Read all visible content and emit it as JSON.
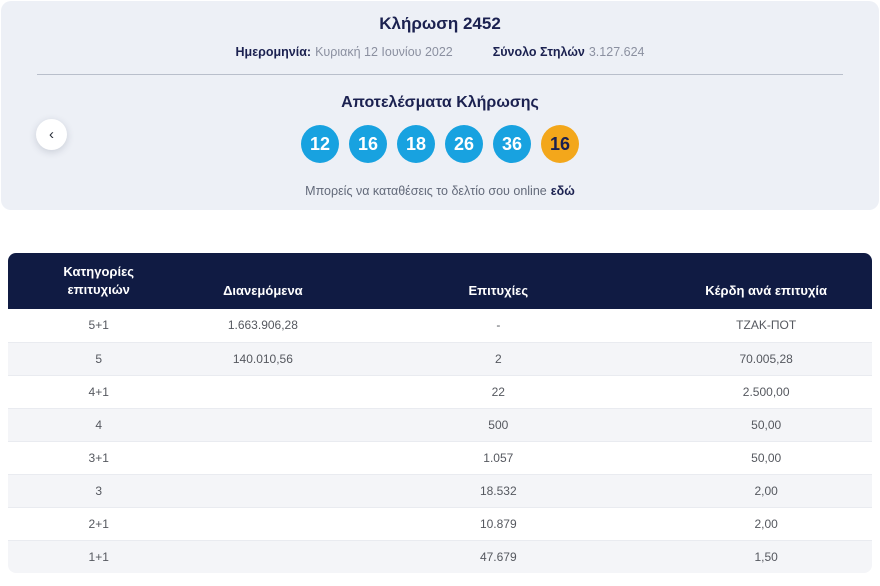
{
  "hero": {
    "title": "Κλήρωση 2452",
    "date_label": "Ημερομηνία:",
    "date_value": "Κυριακή 12 Ιουνίου 2022",
    "columns_label": "Σύνολο Στηλών",
    "columns_value": "3.127.624",
    "results_title": "Αποτελέσματα Κλήρωσης",
    "numbers": [
      "12",
      "16",
      "18",
      "26",
      "36"
    ],
    "joker_number": "16",
    "online_text": "Μπορείς να καταθέσεις το δελτίο σου online",
    "online_link_label": "εδώ",
    "prev_arrow": "‹"
  },
  "colors": {
    "hero_background": "#edf0f6",
    "navy": "#1b2150",
    "table_header_background": "#101b43",
    "ball_blue": "#18a2e0",
    "ball_orange": "#f3a71b",
    "alt_row_background": "#f4f5f8"
  },
  "table": {
    "headers": [
      "Κατηγορίες επιτυχιών",
      "Διανεμόμενα",
      "Επιτυχίες",
      "Κέρδη ανά επιτυχία"
    ],
    "rows": [
      {
        "category": "5+1",
        "distributed": "1.663.906,28",
        "winners": "-",
        "prize": "ΤΖΑΚ-ΠΟΤ"
      },
      {
        "category": "5",
        "distributed": "140.010,56",
        "winners": "2",
        "prize": "70.005,28"
      },
      {
        "category": "4+1",
        "distributed": "",
        "winners": "22",
        "prize": "2.500,00"
      },
      {
        "category": "4",
        "distributed": "",
        "winners": "500",
        "prize": "50,00"
      },
      {
        "category": "3+1",
        "distributed": "",
        "winners": "1.057",
        "prize": "50,00"
      },
      {
        "category": "3",
        "distributed": "",
        "winners": "18.532",
        "prize": "2,00"
      },
      {
        "category": "2+1",
        "distributed": "",
        "winners": "10.879",
        "prize": "2,00"
      },
      {
        "category": "1+1",
        "distributed": "",
        "winners": "47.679",
        "prize": "1,50"
      }
    ]
  }
}
